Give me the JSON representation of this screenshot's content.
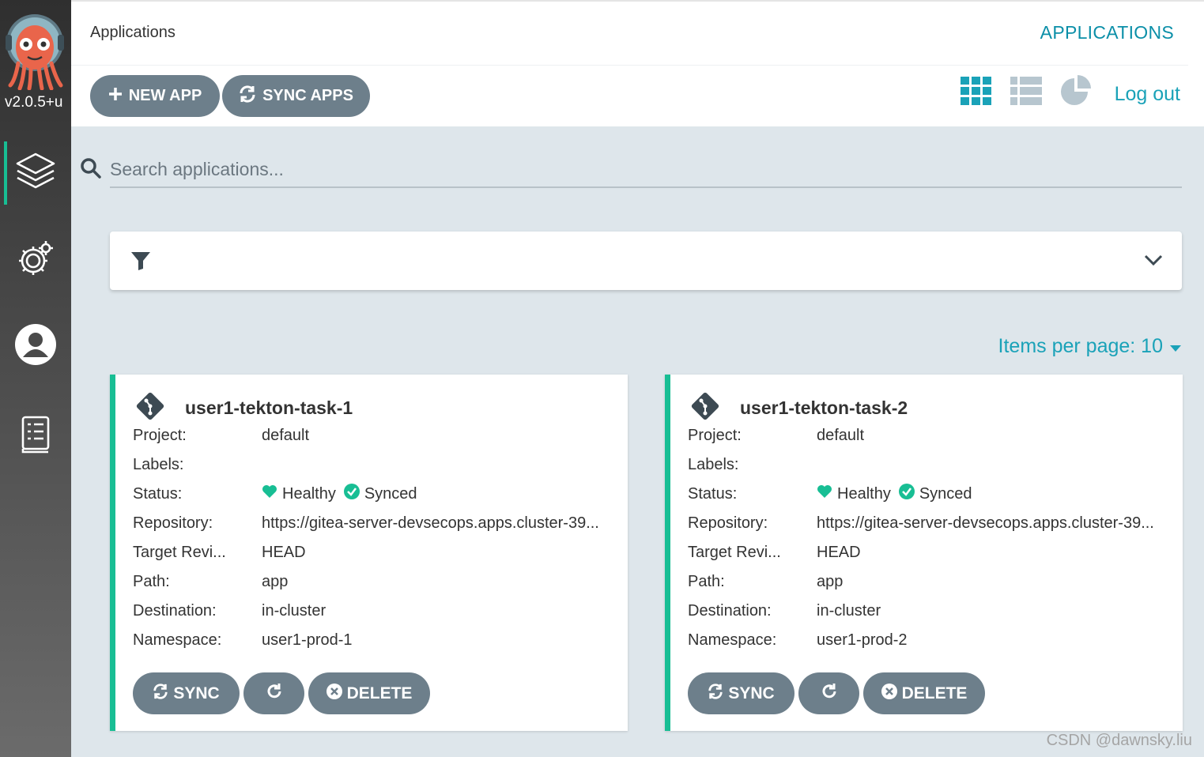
{
  "sidebar": {
    "version": "v2.0.5+u",
    "items": [
      {
        "icon": "layers-icon",
        "active": true
      },
      {
        "icon": "settings-gear-icon",
        "active": false
      },
      {
        "icon": "user-icon",
        "active": false
      },
      {
        "icon": "docs-book-icon",
        "active": false
      }
    ]
  },
  "header": {
    "breadcrumb": "Applications",
    "page_label": "APPLICATIONS",
    "new_app_label": "NEW APP",
    "sync_apps_label": "SYNC APPS",
    "logout_label": "Log out"
  },
  "search": {
    "placeholder": "Search applications..."
  },
  "pagination": {
    "items_per_page": "Items per page: 10"
  },
  "field_labels": {
    "project": "Project:",
    "labels": "Labels:",
    "status": "Status:",
    "repository": "Repository:",
    "target_revision": "Target Revi...",
    "path": "Path:",
    "destination": "Destination:",
    "namespace": "Namespace:"
  },
  "card_buttons": {
    "sync": "SYNC",
    "delete": "DELETE"
  },
  "apps": [
    {
      "name": "user1-tekton-task-1",
      "project": "default",
      "labels": "",
      "health": "Healthy",
      "sync": "Synced",
      "repository": "https://gitea-server-devsecops.apps.cluster-39...",
      "target_revision": "HEAD",
      "path": "app",
      "destination": "in-cluster",
      "namespace": "user1-prod-1"
    },
    {
      "name": "user1-tekton-task-2",
      "project": "default",
      "labels": "",
      "health": "Healthy",
      "sync": "Synced",
      "repository": "https://gitea-server-devsecops.apps.cluster-39...",
      "target_revision": "HEAD",
      "path": "app",
      "destination": "in-cluster",
      "namespace": "user1-prod-2"
    }
  ],
  "colors": {
    "accent": "#18be94",
    "link": "#1aa2b8",
    "button": "#6d7f8b"
  },
  "watermark": "CSDN @dawnsky.liu"
}
